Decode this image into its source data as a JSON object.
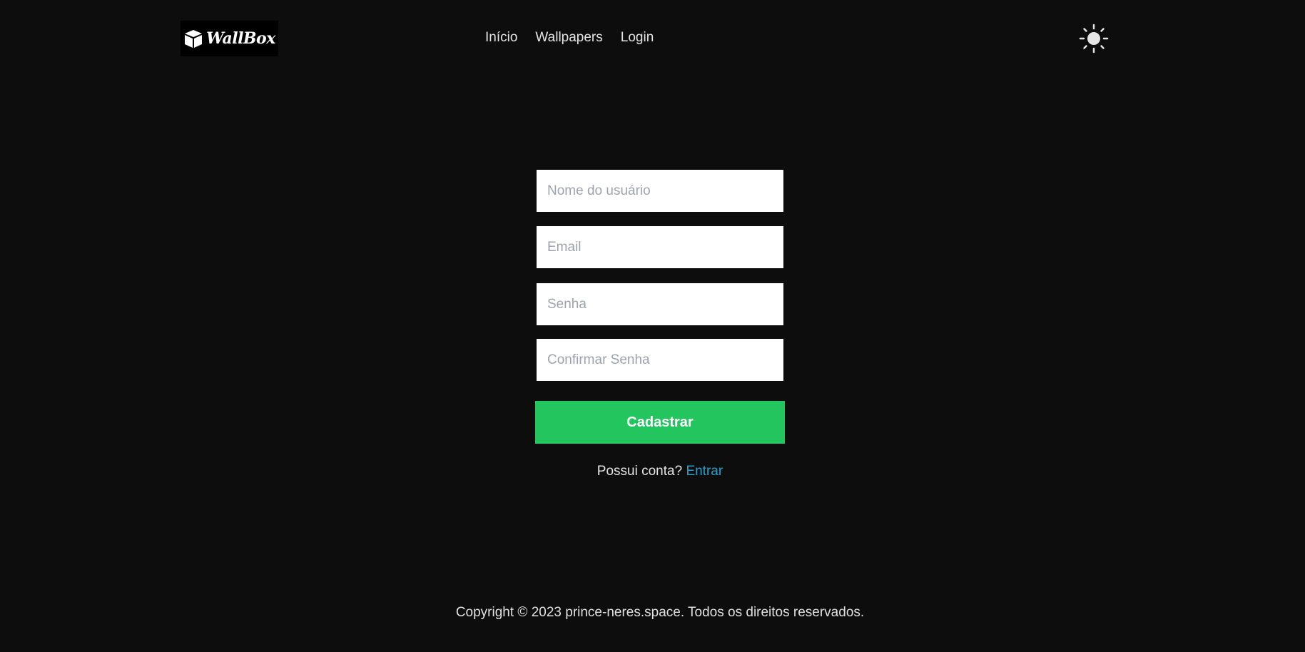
{
  "header": {
    "logo_text": "WallBox",
    "nav": [
      {
        "label": "Início"
      },
      {
        "label": "Wallpapers"
      },
      {
        "label": "Login"
      }
    ],
    "theme_toggle_icon": "sun-icon"
  },
  "form": {
    "username_placeholder": "Nome do usuário",
    "email_placeholder": "Email",
    "password_placeholder": "Senha",
    "confirm_password_placeholder": "Confirmar Senha",
    "submit_label": "Cadastrar",
    "has_account_text": "Possui conta?",
    "signin_link": "Entrar"
  },
  "footer": {
    "copyright": "Copyright © 2023 prince-neres.space. Todos os direitos reservados."
  },
  "colors": {
    "background": "#0d0d0d",
    "accent": "#22c55e",
    "link": "#2a9fc9"
  }
}
